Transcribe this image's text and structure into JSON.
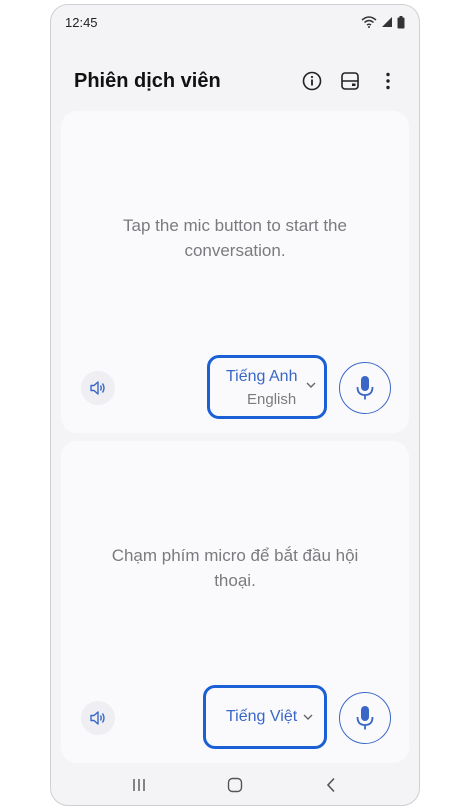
{
  "status": {
    "time": "12:45"
  },
  "header": {
    "title": "Phiên dịch viên"
  },
  "top_panel": {
    "prompt": "Tap the mic button to start the conversation.",
    "language": "Tiếng Anh",
    "language_native": "English"
  },
  "bottom_panel": {
    "prompt": "Chạm phím micro để bắt đầu hội thoại.",
    "language": "Tiếng Việt"
  },
  "colors": {
    "accent": "#3a67c7",
    "highlight": "#1a5fd6",
    "prompt_text": "#7b7b7f"
  }
}
